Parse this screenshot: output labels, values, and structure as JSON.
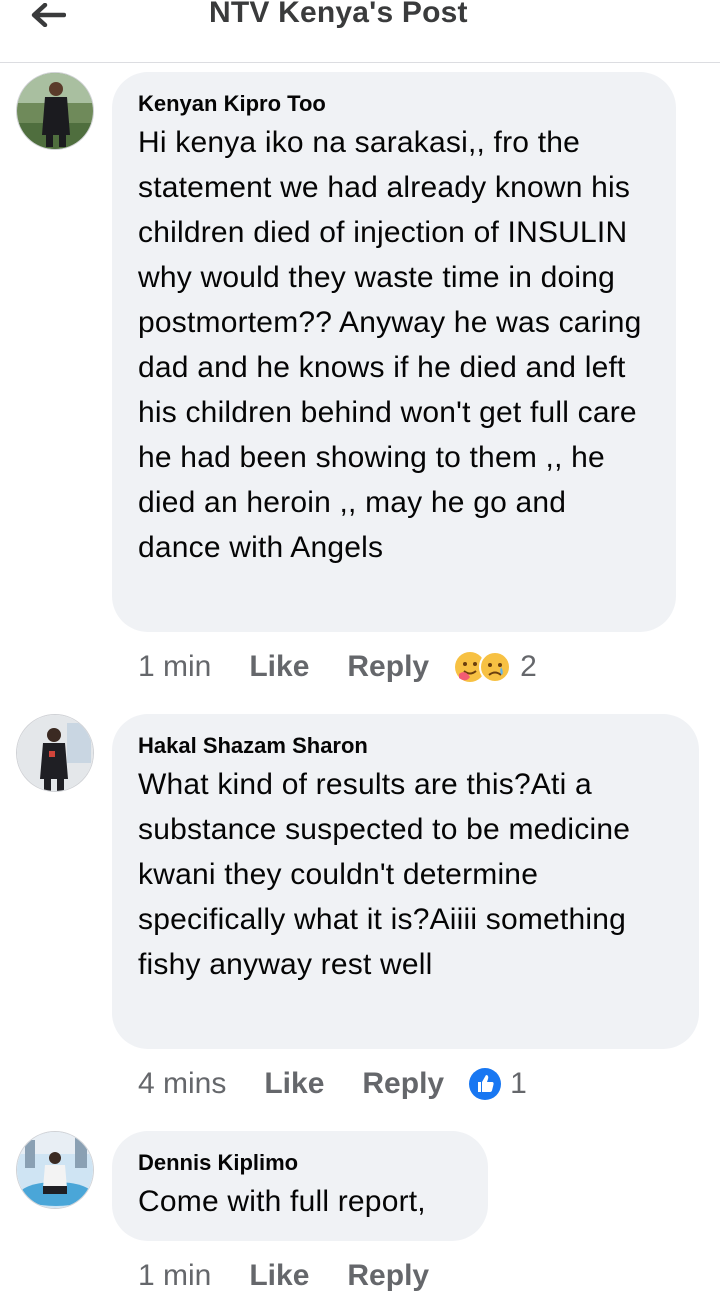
{
  "header": {
    "title": "NTV Kenya's Post",
    "back_icon": "arrow-left-icon"
  },
  "colors": {
    "bubble": "#f0f2f5",
    "meta_text": "#65676b",
    "like_blue": "#1877f2",
    "haha_yellow": "#f7c143"
  },
  "comments": [
    {
      "author": "Kenyan Kipro Too",
      "text": "Hi kenya iko na sarakasi,, fro the statement we had already known his children died of injection of INSULIN why would they waste time in doing postmortem?? Anyway he was caring dad and he knows if he died and left his children behind won't get full care he had been showing to them ,, he died an heroin ,, may he go and dance with Angels",
      "time": "1 min",
      "like_label": "Like",
      "reply_label": "Reply",
      "reactions": [
        "care-face-icon",
        "sad-face-icon"
      ],
      "reaction_count": "2"
    },
    {
      "author": "Hakal Shazam Sharon",
      "text": "What kind of results are this?Ati a substance suspected to be medicine kwani they couldn't determine specifically what it is?Aiiii something fishy anyway rest well",
      "time": "4 mins",
      "like_label": "Like",
      "reply_label": "Reply",
      "reactions": [
        "thumbs-up-icon"
      ],
      "reaction_count": "1"
    },
    {
      "author": "Dennis Kiplimo",
      "text": "Come with full report,",
      "time": "1 min",
      "like_label": "Like",
      "reply_label": "Reply"
    }
  ]
}
